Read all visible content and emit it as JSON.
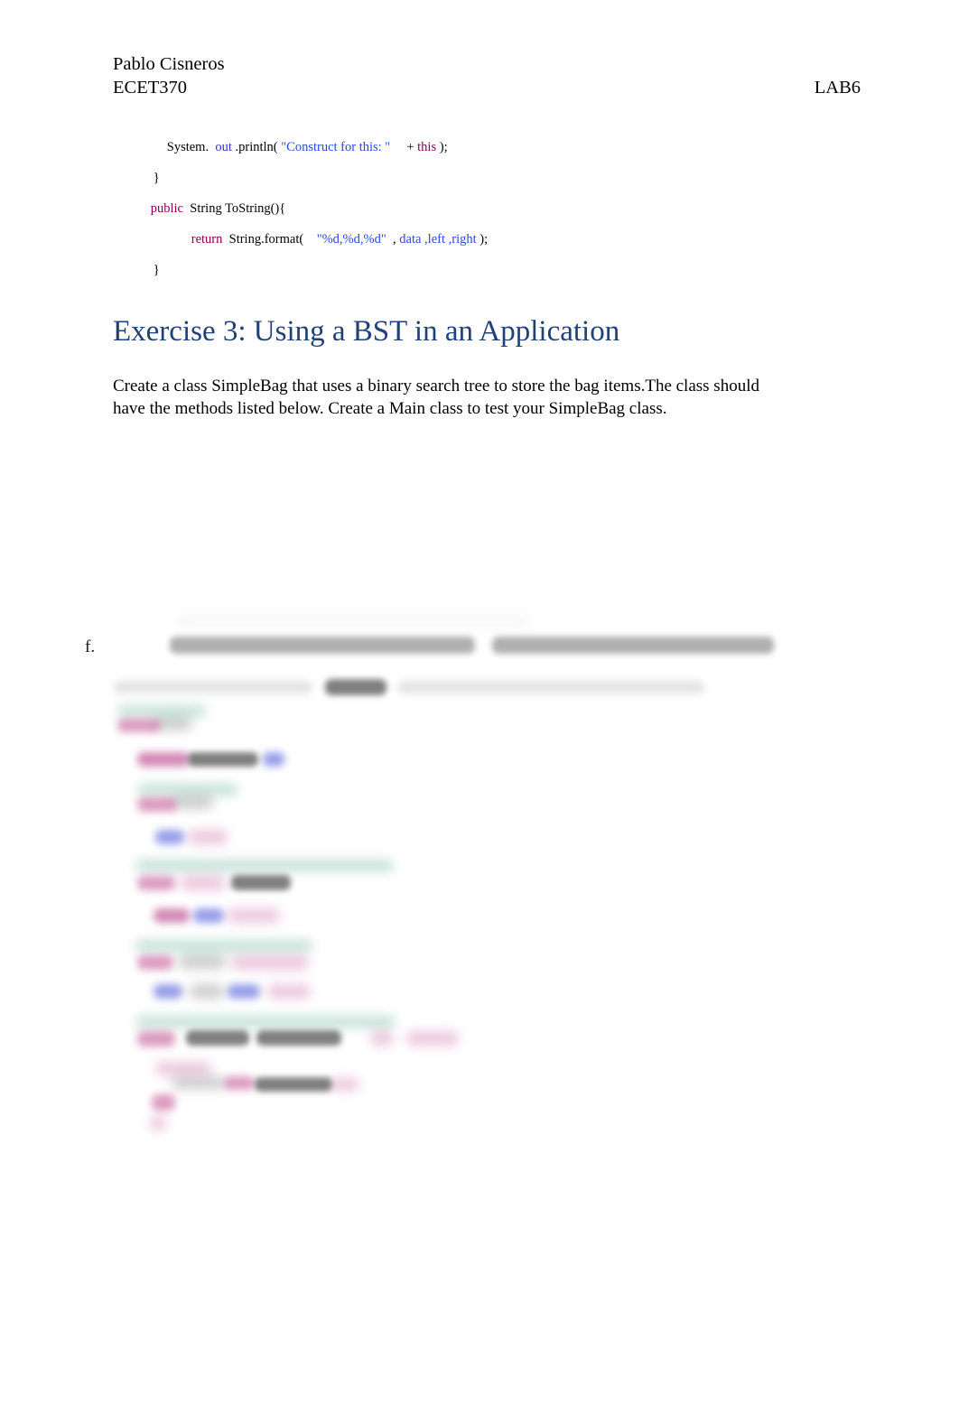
{
  "document": {
    "page_background": "#ffffff",
    "heading_color": "#1F4178"
  },
  "header": {
    "author": "Pablo Cisneros",
    "course": "ECET370",
    "lab": "LAB6"
  },
  "code_snippet": {
    "language": "java",
    "lines": [
      {
        "indent": 1,
        "tokens": [
          {
            "text": "System.",
            "style": "plain"
          },
          {
            "text": "out",
            "style": "kwb"
          },
          {
            "text": ".println(",
            "style": "plain"
          },
          {
            "text": "\"Construct for this: \"",
            "style": "str"
          },
          {
            "text": "+",
            "style": "plain"
          },
          {
            "text": "this",
            "style": "kw"
          },
          {
            "text": ");",
            "style": "plain"
          }
        ]
      },
      {
        "indent": 0,
        "tokens": [
          {
            "text": "}",
            "style": "plain"
          }
        ]
      },
      {
        "indent": 0,
        "tokens": [
          {
            "text": "public",
            "style": "kw"
          },
          {
            "text": "String ToString(){",
            "style": "plain"
          }
        ]
      },
      {
        "indent": 2,
        "tokens": [
          {
            "text": "return",
            "style": "kw"
          },
          {
            "text": "String.format(",
            "style": "plain"
          },
          {
            "text": "\"%d,%d,%d\"",
            "style": "str"
          },
          {
            "text": ",",
            "style": "plain"
          },
          {
            "text": "data",
            "style": "field"
          },
          {
            "text": ",left",
            "style": "field"
          },
          {
            "text": ",right",
            "style": "field"
          },
          {
            "text": ");",
            "style": "plain"
          }
        ]
      },
      {
        "indent": 0,
        "tokens": [
          {
            "text": "}",
            "style": "plain"
          }
        ]
      }
    ],
    "rendered": {
      "l1_system": "System.",
      "l1_out": "out",
      "l1_println": ".println(",
      "l1_string": "\"Construct for this: \"",
      "l1_plus": "+",
      "l1_this": "this",
      "l1_end": ");",
      "l2_brace": "}",
      "l3_public": "public",
      "l3_sig": "String ToString(){",
      "l4_return": "return",
      "l4_format": "String.format(",
      "l4_fmtstr": "\"%d,%d,%d\"",
      "l4_comma": ",",
      "l4_data": "data",
      "l4_left": ",left",
      "l4_right": ",right",
      "l4_end": ");",
      "l5_brace": "}"
    }
  },
  "exercise": {
    "heading": "Exercise 3: Using a BST in an Application",
    "body": "Create a class SimpleBag that uses a binary search tree to store the bag items.The class should have the methods listed below. Create a Main class to test your SimpleBag class."
  },
  "redacted_section": {
    "list_marker": "f.",
    "list_item_text": "",
    "note": "blurred/illegible"
  }
}
